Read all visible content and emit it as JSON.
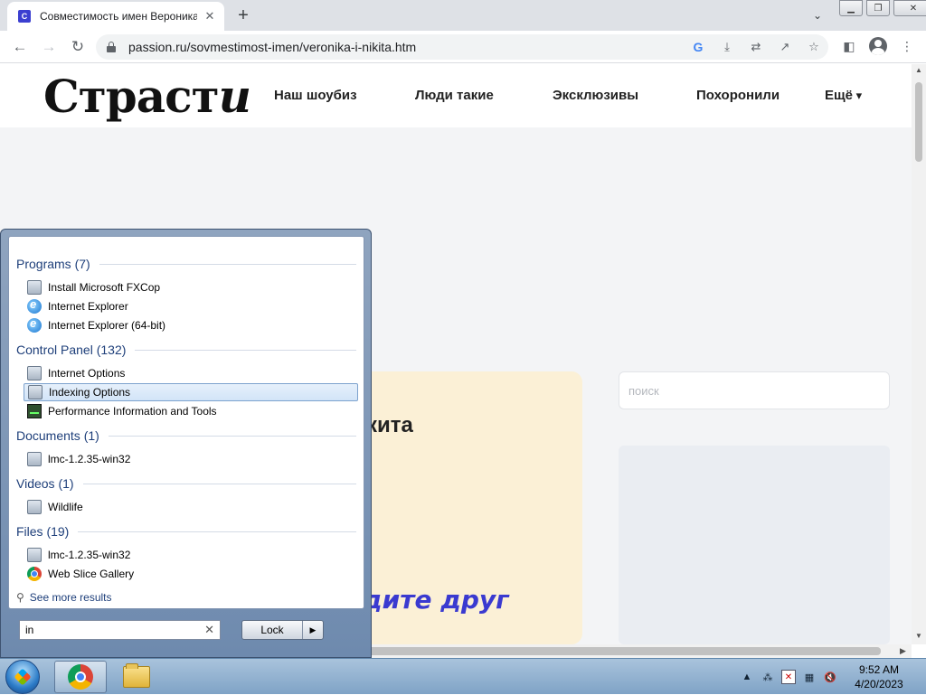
{
  "browser": {
    "tab_title": "Совместимость имен Вероника",
    "tab_favicon": "С",
    "url": "passion.ru/sovmestimost-imen/veronika-i-nikita.htm"
  },
  "site": {
    "logo_main": "Страст",
    "logo_italic": "и",
    "nav": [
      "Наш шоубиз",
      "Люди такие",
      "Эксклюзивы",
      "Похоронили",
      "Ещё"
    ],
    "article_title_fragment": "кита",
    "article_sub_fragment": "дите друг",
    "search_placeholder": "поиск"
  },
  "start_menu": {
    "categories": [
      {
        "label": "Programs (7)",
        "items": [
          "Install Microsoft FXCop",
          "Internet Explorer",
          "Internet Explorer (64-bit)"
        ]
      },
      {
        "label": "Control Panel (132)",
        "items": [
          "Internet Options",
          "Indexing Options",
          "Performance Information and Tools"
        ]
      },
      {
        "label": "Documents (1)",
        "items": [
          "lmc-1.2.35-win32"
        ]
      },
      {
        "label": "Videos (1)",
        "items": [
          "Wildlife"
        ]
      },
      {
        "label": "Files (19)",
        "items": [
          "lmc-1.2.35-win32",
          "Web Slice Gallery"
        ]
      }
    ],
    "selected_item": "Indexing Options",
    "see_more": "See more results",
    "search_value": "in",
    "lock_label": "Lock"
  },
  "taskbar": {
    "time": "9:52 AM",
    "date": "4/20/2023"
  },
  "colors": {
    "accent_blue": "#3a3ad0",
    "article_card": "#fbf0d6",
    "start_menu_frame": "#7f98b9"
  }
}
